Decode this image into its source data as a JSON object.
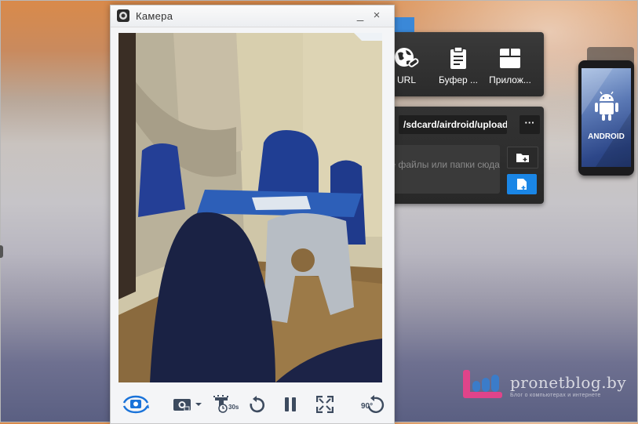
{
  "camera_window": {
    "title": "Камера",
    "minimize_label": "_",
    "close_label": "×"
  },
  "tools": {
    "url_label": "URL",
    "clipboard_label": "Буфер ...",
    "apps_label": "Прилож..."
  },
  "upload": {
    "path": "/sdcard/airdroid/upload",
    "more_label": "···",
    "drop_hint": "те файлы или папки сюда"
  },
  "device": {
    "label": "ANDROID"
  },
  "camera_toolbar": {
    "timer_badge": "30s",
    "rotate_badge": "90°"
  },
  "watermark": {
    "site": "pronetblog.by",
    "tagline": "Блог о компьютерах и интернете"
  },
  "colors": {
    "accent_blue": "#1a86e6",
    "panel_dark": "#2b2b2b",
    "watermark_pink": "#e0448a"
  }
}
